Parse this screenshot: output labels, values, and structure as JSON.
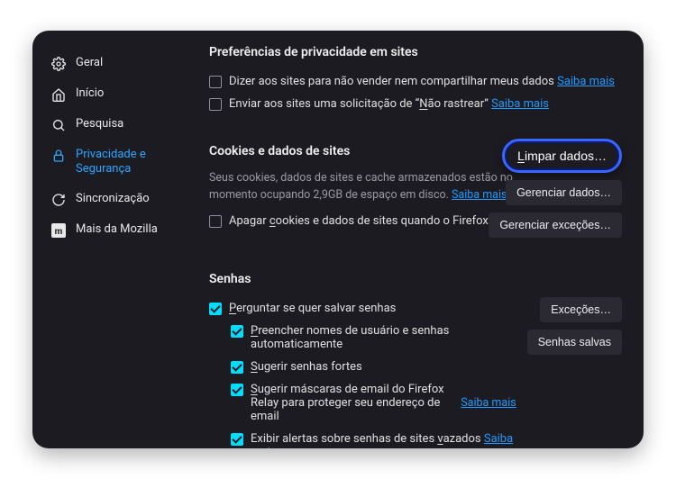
{
  "sidebar": {
    "items": [
      {
        "label": "Geral"
      },
      {
        "label": "Início"
      },
      {
        "label": "Pesquisa"
      },
      {
        "label": "Privacidade e Segurança"
      },
      {
        "label": "Sincronização"
      },
      {
        "label": "Mais da Mozilla"
      }
    ]
  },
  "sections": {
    "site_prefs": {
      "title": "Preferências de privacidade em sites",
      "opt1_pre": "Dizer aos sites para não vender nem compartilhar meus dados  ",
      "opt1_link": "Saiba mais",
      "opt2_pre": "Enviar aos sites uma solicitação de “",
      "opt2_under_n": "N",
      "opt2_rest": "ão rastrear”  ",
      "opt2_link": "Saiba mais"
    },
    "cookies": {
      "title": "Cookies e dados de sites",
      "desc_pre": "Seus cookies, dados de sites e cache armazenados estão no momento ocupando 2,9GB de espaço em disco. ",
      "desc_link": "Saiba mais",
      "clear_c": "c",
      "clear_rest": "ookies e dados de sites quando o Firefox for fechado",
      "clear_pre": "Apagar ",
      "btn_clear_under": "L",
      "btn_clear_rest": "impar dados…",
      "btn_manage_data": "Gerenciar dados…",
      "btn_manage_exc": "Gerenciar exceções…"
    },
    "passwords": {
      "title": "Senhas",
      "ask_p": "P",
      "ask_rest": "erguntar se quer salvar senhas",
      "btn_exc": "Exceções…",
      "btn_saved": "Senhas salvas",
      "fill_p": "P",
      "fill_rest": "reencher nomes de usuário e senhas automaticamente",
      "suggest_s": "S",
      "suggest_rest": "ugerir senhas fortes",
      "relay_s": "S",
      "relay_rest": "ugerir máscaras de email do Firefox Relay para proteger seu endereço de email",
      "relay_link": "Saiba mais",
      "leaked_pre": "Exibir alertas sobre senhas de sites ",
      "leaked_v": "v",
      "leaked_rest": "azados  ",
      "leaked_link": "Saiba mais"
    }
  }
}
